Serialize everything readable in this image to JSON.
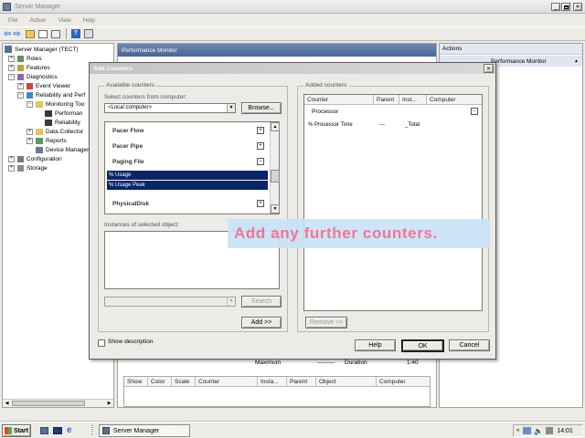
{
  "window": {
    "title": "Server Manager"
  },
  "menu": {
    "file": "File",
    "action": "Action",
    "view": "View",
    "help": "Help"
  },
  "tree": {
    "root": "Server Manager (TECT)",
    "roles": "Roles",
    "features": "Features",
    "diagnostics": "Diagnostics",
    "event_viewer": "Event Viewer",
    "reliability": "Reliability and Perf",
    "monitoring_tools": "Monitoring Too",
    "performance": "Performan",
    "reliability_mon": "Reliability",
    "data_collector": "Data Collector",
    "reports": "Reports",
    "device_manager": "Device Manager",
    "configuration": "Configuration",
    "storage": "Storage"
  },
  "center": {
    "title": "Performance Monitor"
  },
  "actions_pane": {
    "title": "Actions",
    "item": "Performance Monitor"
  },
  "bottom_grid": {
    "maximum_label": "Maximum",
    "maximum_value": "---------",
    "duration_label": "Duration",
    "duration_value": "1:40",
    "columns": [
      "Show",
      "Color",
      "Scale",
      "Counter",
      "Insta...",
      "Parent",
      "Object",
      "Computer"
    ]
  },
  "dialog": {
    "title": "Add Counters",
    "available_label": "Available counters",
    "select_from": "Select counters from computer:",
    "computer_value": "<Local computer>",
    "browse": "Browse...",
    "counters": [
      {
        "label": "Pacer Flow",
        "type": "group"
      },
      {
        "label": "Pacer Pipe",
        "type": "group"
      },
      {
        "label": "Paging File",
        "type": "open"
      },
      {
        "label": "% Usage",
        "type": "selected"
      },
      {
        "label": "% Usage Peak",
        "type": "selected"
      },
      {
        "label": "PhysicalDisk",
        "type": "group"
      }
    ],
    "instances_label": "Instances of selected object:",
    "search": "Search",
    "add": "Add >>",
    "added_label": "Added counters",
    "added_columns": [
      "Counter",
      "Parent",
      "Inst...",
      "Computer"
    ],
    "added_group": "Processor",
    "added_row": {
      "counter": "% Processor Time",
      "parent": "---",
      "instance": "_Total",
      "computer": ""
    },
    "remove": "Remove <<",
    "show_description": "Show description",
    "help": "Help",
    "ok": "OK",
    "cancel": "Cancel"
  },
  "callout": {
    "text": "Add any further counters."
  },
  "taskbar": {
    "start": "Start",
    "task": "Server Manager",
    "clock": "14:01"
  },
  "colors": {
    "title_active": "#0a246a",
    "title_inactive": "#808080",
    "dialog_bg": "#ecebe6",
    "selection": "#0a246a",
    "callout_bg": "#c9e3f6",
    "callout_text": "#f06b8e",
    "taskbar": "#ecebe6"
  }
}
